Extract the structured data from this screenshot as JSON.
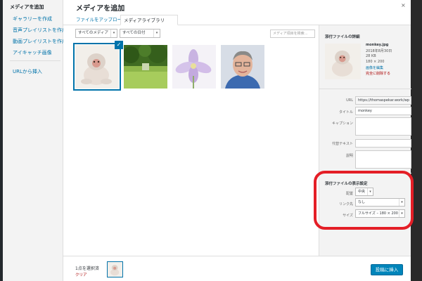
{
  "menu": {
    "title": "メディアを追加",
    "items": [
      "ギャラリーを作成",
      "音声プレイリストを作成",
      "動画プレイリストを作成",
      "アイキャッチ画像",
      "URLから挿入"
    ]
  },
  "modal": {
    "title": "メディアを追加",
    "close_icon": "×",
    "tabs": {
      "upload": "ファイルをアップロード",
      "library": "メディアライブラリ"
    },
    "filters": {
      "media_type": "すべてのメディア",
      "date": "すべての日付"
    },
    "search_placeholder": "メディア項目を検索…",
    "thumbnails": [
      "monkey",
      "park",
      "flower",
      "portrait"
    ]
  },
  "details": {
    "heading": "添付ファイルの詳細",
    "file": {
      "name": "monkey.jpg",
      "date": "2018年8月30日",
      "size": "28 KB",
      "dimensions": "180 × 200",
      "edit_link": "画像を編集",
      "delete_link": "完全に削除する"
    },
    "fields": {
      "url_label": "URL",
      "url_value": "https://thomaspekar.work/wp",
      "title_label": "タイトル",
      "title_value": "monkey",
      "caption_label": "キャプション",
      "alt_label": "代替テキスト",
      "desc_label": "説明"
    },
    "display": {
      "heading": "添付ファイルの表示設定",
      "align_label": "配置",
      "align_value": "中央",
      "link_label": "リンク先",
      "link_value": "なし",
      "size_label": "サイズ",
      "size_value": "フルサイズ – 180 × 200"
    }
  },
  "toolbar": {
    "selected_count": "1点を選択済",
    "clear": "クリア",
    "insert_button": "投稿に挿入"
  },
  "colors": {
    "accent": "#0085ba",
    "link": "#0073aa",
    "highlight_ring": "#e41e26"
  }
}
